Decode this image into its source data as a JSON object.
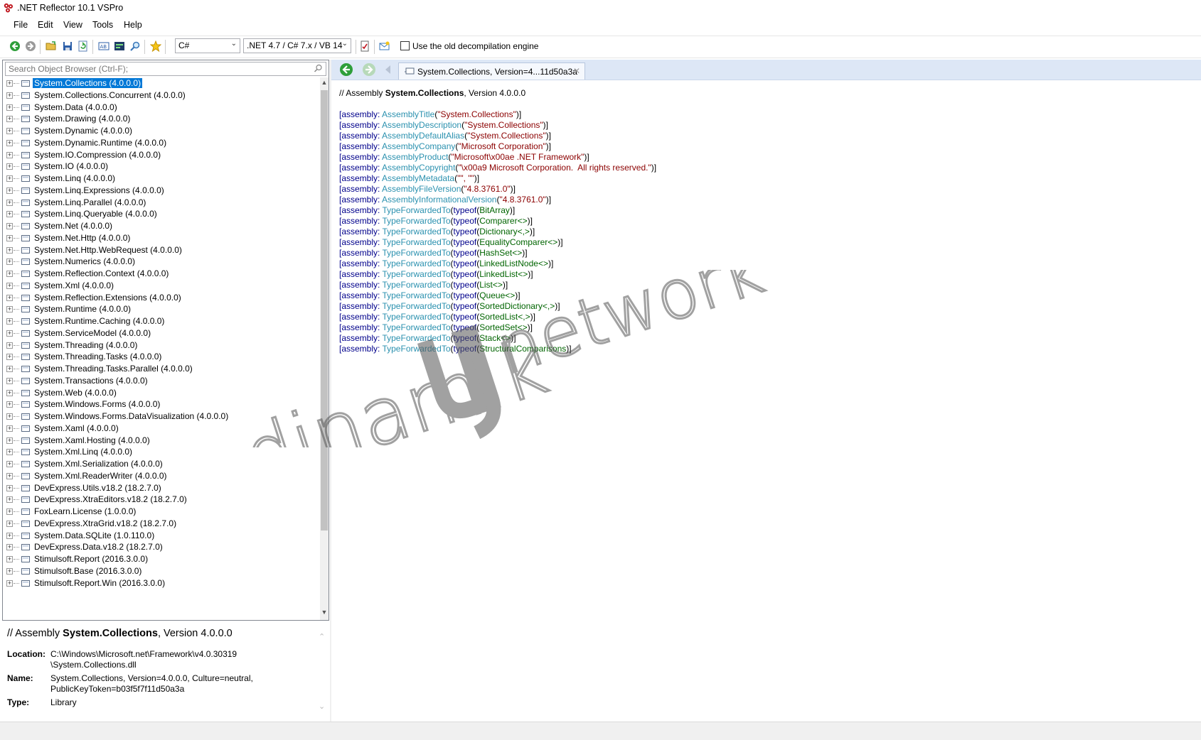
{
  "window": {
    "title": ".NET Reflector 10.1 VSPro"
  },
  "menu": [
    "File",
    "Edit",
    "View",
    "Tools",
    "Help"
  ],
  "toolbar": {
    "language": "C#",
    "framework": ".NET 4.7 / C# 7.x / VB 14",
    "old_engine_label": "Use the old decompilation engine",
    "old_engine_checked": false
  },
  "search": {
    "placeholder": "Search Object Browser (Ctrl-F);"
  },
  "tree": [
    "System.Collections (4.0.0.0)",
    "System.Collections.Concurrent (4.0.0.0)",
    "System.Data (4.0.0.0)",
    "System.Drawing (4.0.0.0)",
    "System.Dynamic (4.0.0.0)",
    "System.Dynamic.Runtime (4.0.0.0)",
    "System.IO.Compression (4.0.0.0)",
    "System.IO (4.0.0.0)",
    "System.Linq (4.0.0.0)",
    "System.Linq.Expressions (4.0.0.0)",
    "System.Linq.Parallel (4.0.0.0)",
    "System.Linq.Queryable (4.0.0.0)",
    "System.Net (4.0.0.0)",
    "System.Net.Http (4.0.0.0)",
    "System.Net.Http.WebRequest (4.0.0.0)",
    "System.Numerics (4.0.0.0)",
    "System.Reflection.Context (4.0.0.0)",
    "System.Xml (4.0.0.0)",
    "System.Reflection.Extensions (4.0.0.0)",
    "System.Runtime (4.0.0.0)",
    "System.Runtime.Caching (4.0.0.0)",
    "System.ServiceModel (4.0.0.0)",
    "System.Threading (4.0.0.0)",
    "System.Threading.Tasks (4.0.0.0)",
    "System.Threading.Tasks.Parallel (4.0.0.0)",
    "System.Transactions (4.0.0.0)",
    "System.Web (4.0.0.0)",
    "System.Windows.Forms (4.0.0.0)",
    "System.Windows.Forms.DataVisualization (4.0.0.0)",
    "System.Xaml (4.0.0.0)",
    "System.Xaml.Hosting (4.0.0.0)",
    "System.Xml.Linq (4.0.0.0)",
    "System.Xml.Serialization (4.0.0.0)",
    "System.Xml.ReaderWriter (4.0.0.0)",
    "DevExpress.Utils.v18.2 (18.2.7.0)",
    "DevExpress.XtraEditors.v18.2 (18.2.7.0)",
    "FoxLearn.License (1.0.0.0)",
    "DevExpress.XtraGrid.v18.2 (18.2.7.0)",
    "System.Data.SQLite (1.0.110.0)",
    "DevExpress.Data.v18.2 (18.2.7.0)",
    "Stimulsoft.Report (2016.3.0.0)",
    "Stimulsoft.Base (2016.3.0.0)",
    "Stimulsoft.Report.Win (2016.3.0.0)"
  ],
  "info": {
    "prefix": "// Assembly ",
    "name": "System.Collections",
    "suffix": ", Version 4.0.0.0",
    "location_label": "Location:",
    "location_1": "C:\\Windows\\Microsoft.net\\Framework\\v4.0.30319",
    "location_2": "\\System.Collections.dll",
    "name_label": "Name:",
    "name_1": "System.Collections, Version=4.0.0.0, Culture=neutral,",
    "name_2": "PublicKeyToken=b03f5f7f11d50a3a",
    "type_label": "Type:",
    "type_value": "Library"
  },
  "tab": {
    "label": "System.Collections, Version=4...11d50a3a"
  },
  "code": {
    "header_prefix": "// Assembly ",
    "header_name": "System.Collections",
    "header_suffix": ", Version 4.0.0.0",
    "lines": [
      [
        [
          "[assembly: ",
          "kw"
        ],
        [
          "AssemblyTitle",
          "ty"
        ],
        [
          "(",
          ""
        ],
        [
          "\"System.Collections\"",
          "st"
        ],
        [
          ")]",
          ""
        ]
      ],
      [
        [
          "[assembly: ",
          "kw"
        ],
        [
          "AssemblyDescription",
          "ty"
        ],
        [
          "(",
          ""
        ],
        [
          "\"System.Collections\"",
          "st"
        ],
        [
          ")]",
          ""
        ]
      ],
      [
        [
          "[assembly: ",
          "kw"
        ],
        [
          "AssemblyDefaultAlias",
          "ty"
        ],
        [
          "(",
          ""
        ],
        [
          "\"System.Collections\"",
          "st"
        ],
        [
          ")]",
          ""
        ]
      ],
      [
        [
          "[assembly: ",
          "kw"
        ],
        [
          "AssemblyCompany",
          "ty"
        ],
        [
          "(",
          ""
        ],
        [
          "\"Microsoft Corporation\"",
          "st"
        ],
        [
          ")]",
          ""
        ]
      ],
      [
        [
          "[assembly: ",
          "kw"
        ],
        [
          "AssemblyProduct",
          "ty"
        ],
        [
          "(",
          ""
        ],
        [
          "\"Microsoft\\x00ae .NET Framework\"",
          "st"
        ],
        [
          ")]",
          ""
        ]
      ],
      [
        [
          "[assembly: ",
          "kw"
        ],
        [
          "AssemblyCopyright",
          "ty"
        ],
        [
          "(",
          ""
        ],
        [
          "\"\\x00a9 Microsoft Corporation.  All rights reserved.\"",
          "st"
        ],
        [
          ")]",
          ""
        ]
      ],
      [
        [
          "[assembly: ",
          "kw"
        ],
        [
          "AssemblyMetadata",
          "ty"
        ],
        [
          "(",
          ""
        ],
        [
          "\"\", \"\"",
          "st"
        ],
        [
          ")]",
          ""
        ]
      ],
      [
        [
          "[assembly: ",
          "kw"
        ],
        [
          "AssemblyFileVersion",
          "ty"
        ],
        [
          "(",
          ""
        ],
        [
          "\"4.8.3761.0\"",
          "st"
        ],
        [
          ")]",
          ""
        ]
      ],
      [
        [
          "[assembly: ",
          "kw"
        ],
        [
          "AssemblyInformationalVersion",
          "ty"
        ],
        [
          "(",
          ""
        ],
        [
          "\"4.8.3761.0\"",
          "st"
        ],
        [
          ")]",
          ""
        ]
      ],
      [
        [
          "[assembly: ",
          "kw"
        ],
        [
          "TypeForwardedTo",
          "ty"
        ],
        [
          "(",
          ""
        ],
        [
          "typeof",
          "kw"
        ],
        [
          "(",
          ""
        ],
        [
          "BitArray",
          "tyg"
        ],
        [
          ")]",
          ""
        ]
      ],
      [
        [
          "[assembly: ",
          "kw"
        ],
        [
          "TypeForwardedTo",
          "ty"
        ],
        [
          "(",
          ""
        ],
        [
          "typeof",
          "kw"
        ],
        [
          "(",
          ""
        ],
        [
          "Comparer<>",
          "tyg"
        ],
        [
          ")]",
          ""
        ]
      ],
      [
        [
          "[assembly: ",
          "kw"
        ],
        [
          "TypeForwardedTo",
          "ty"
        ],
        [
          "(",
          ""
        ],
        [
          "typeof",
          "kw"
        ],
        [
          "(",
          ""
        ],
        [
          "Dictionary<,>",
          "tyg"
        ],
        [
          ")]",
          ""
        ]
      ],
      [
        [
          "[assembly: ",
          "kw"
        ],
        [
          "TypeForwardedTo",
          "ty"
        ],
        [
          "(",
          ""
        ],
        [
          "typeof",
          "kw"
        ],
        [
          "(",
          ""
        ],
        [
          "EqualityComparer<>",
          "tyg"
        ],
        [
          ")]",
          ""
        ]
      ],
      [
        [
          "[assembly: ",
          "kw"
        ],
        [
          "TypeForwardedTo",
          "ty"
        ],
        [
          "(",
          ""
        ],
        [
          "typeof",
          "kw"
        ],
        [
          "(",
          ""
        ],
        [
          "HashSet<>",
          "tyg"
        ],
        [
          ")]",
          ""
        ]
      ],
      [
        [
          "[assembly: ",
          "kw"
        ],
        [
          "TypeForwardedTo",
          "ty"
        ],
        [
          "(",
          ""
        ],
        [
          "typeof",
          "kw"
        ],
        [
          "(",
          ""
        ],
        [
          "LinkedListNode<>",
          "tyg"
        ],
        [
          ")]",
          ""
        ]
      ],
      [
        [
          "[assembly: ",
          "kw"
        ],
        [
          "TypeForwardedTo",
          "ty"
        ],
        [
          "(",
          ""
        ],
        [
          "typeof",
          "kw"
        ],
        [
          "(",
          ""
        ],
        [
          "LinkedList<>",
          "tyg"
        ],
        [
          ")]",
          ""
        ]
      ],
      [
        [
          "[assembly: ",
          "kw"
        ],
        [
          "TypeForwardedTo",
          "ty"
        ],
        [
          "(",
          ""
        ],
        [
          "typeof",
          "kw"
        ],
        [
          "(",
          ""
        ],
        [
          "List<>",
          "tyg"
        ],
        [
          ")]",
          ""
        ]
      ],
      [
        [
          "[assembly: ",
          "kw"
        ],
        [
          "TypeForwardedTo",
          "ty"
        ],
        [
          "(",
          ""
        ],
        [
          "typeof",
          "kw"
        ],
        [
          "(",
          ""
        ],
        [
          "Queue<>",
          "tyg"
        ],
        [
          ")]",
          ""
        ]
      ],
      [
        [
          "[assembly: ",
          "kw"
        ],
        [
          "TypeForwardedTo",
          "ty"
        ],
        [
          "(",
          ""
        ],
        [
          "typeof",
          "kw"
        ],
        [
          "(",
          ""
        ],
        [
          "SortedDictionary<,>",
          "tyg"
        ],
        [
          ")]",
          ""
        ]
      ],
      [
        [
          "[assembly: ",
          "kw"
        ],
        [
          "TypeForwardedTo",
          "ty"
        ],
        [
          "(",
          ""
        ],
        [
          "typeof",
          "kw"
        ],
        [
          "(",
          ""
        ],
        [
          "SortedList<,>",
          "tyg"
        ],
        [
          ")]",
          ""
        ]
      ],
      [
        [
          "[assembly: ",
          "kw"
        ],
        [
          "TypeForwardedTo",
          "ty"
        ],
        [
          "(",
          ""
        ],
        [
          "typeof",
          "kw"
        ],
        [
          "(",
          ""
        ],
        [
          "SortedSet<>",
          "tyg"
        ],
        [
          ")]",
          ""
        ]
      ],
      [
        [
          "[assembly: ",
          "kw"
        ],
        [
          "TypeForwardedTo",
          "ty"
        ],
        [
          "(",
          ""
        ],
        [
          "typeof",
          "kw"
        ],
        [
          "(",
          ""
        ],
        [
          "Stack<>",
          "tyg"
        ],
        [
          ")]",
          ""
        ]
      ],
      [
        [
          "[assembly: ",
          "kw"
        ],
        [
          "TypeForwardedTo",
          "ty"
        ],
        [
          "(",
          ""
        ],
        [
          "typeof",
          "kw"
        ],
        [
          "(",
          ""
        ],
        [
          "StructuralComparisons",
          "tyg"
        ],
        [
          ")]",
          ""
        ]
      ]
    ]
  },
  "watermark": {
    "text_left": "dinamik",
    "text_right": "network"
  },
  "colors": {
    "selection": "#0078d7",
    "keyword": "#00008b",
    "type": "#2b91af",
    "string": "#8b0000",
    "nav_bg": "#dde7f6"
  }
}
